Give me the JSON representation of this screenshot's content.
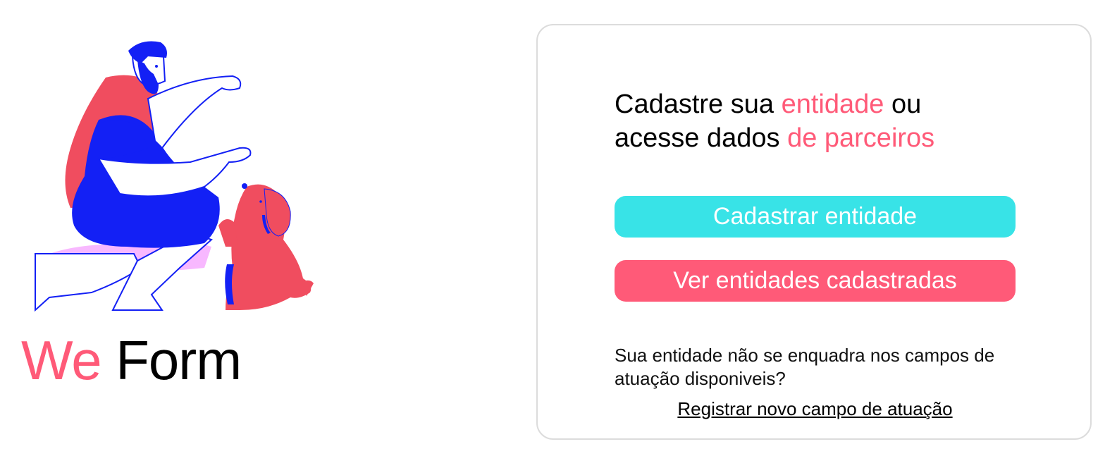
{
  "brand": {
    "we": "We",
    "form": "Form"
  },
  "headline": {
    "part1": "Cadastre sua ",
    "highlight1": "entidade",
    "part2": " ou",
    "part3": "acesse dados ",
    "highlight2": "de parceiros"
  },
  "buttons": {
    "register": "Cadastrar entidade",
    "view": "Ver entidades cadastradas"
  },
  "note": "Sua entidade não se enquadra nos campos de atuação disponiveis?",
  "link": "Registrar novo campo de atuação",
  "colors": {
    "accent_pink": "#ff5a78",
    "accent_cyan": "#38e3e7",
    "illustration_blue": "#1320f5",
    "illustration_red": "#f04d5f",
    "illustration_lilac": "#f8b8ff"
  },
  "icons": {
    "illustration": "man-with-dog-illustration"
  }
}
